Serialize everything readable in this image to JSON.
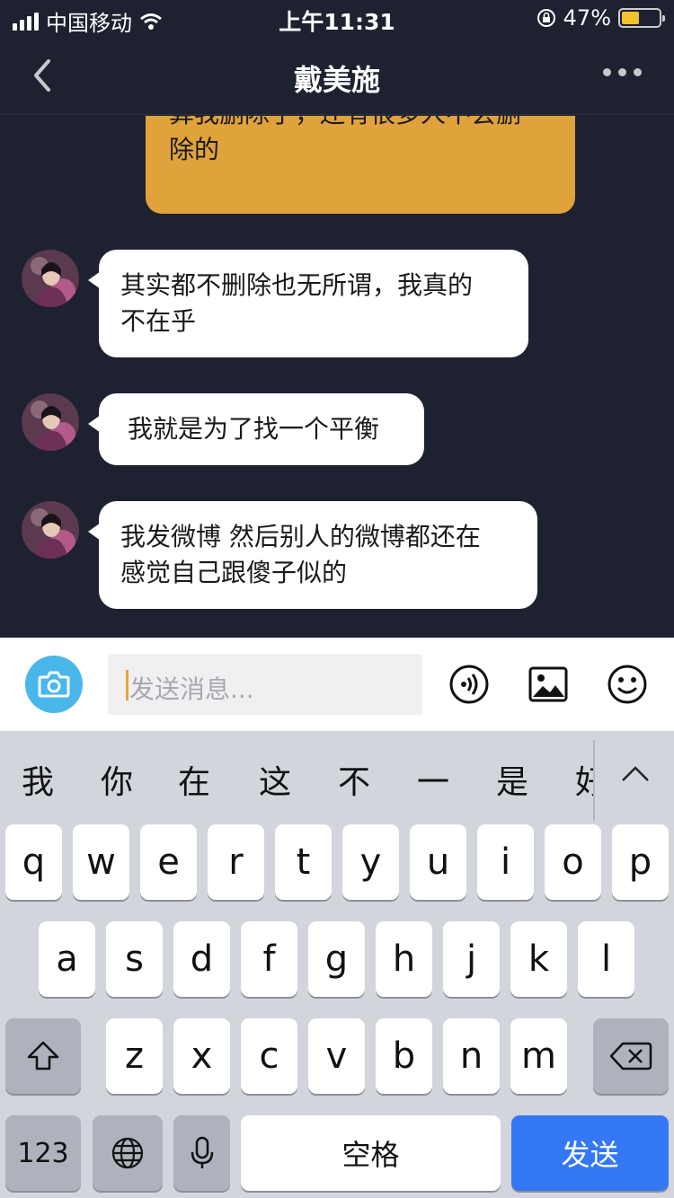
{
  "status_bar": {
    "carrier": "中国移动",
    "time": "上午11:31",
    "battery_percent": "47%",
    "battery_level": 0.47,
    "icons": [
      "signal-icon",
      "wifi-icon",
      "rotation-lock-icon",
      "battery-icon"
    ]
  },
  "nav": {
    "title": "戴美施",
    "back_icon": "chevron-left-icon",
    "more_icon": "more-dots-icon"
  },
  "messages": {
    "self_partial": "算我删除了，还有很多人不会删除的",
    "self_line1": "算我删除了，还有很多人不会删",
    "self_line2": "除的",
    "m1_line1": "其实都不删除也无所谓，我真的",
    "m1_line2": "不在乎",
    "m2_line1": "我就是为了找一个平衡",
    "m3_line1": "我发微博 然后别人的微博都还在",
    "m3_line2": "感觉自己跟傻子似的"
  },
  "input": {
    "placeholder": "发送消息...",
    "icons": [
      "camera-icon",
      "voice-icon",
      "image-icon",
      "emoji-icon"
    ]
  },
  "keyboard": {
    "candidates": [
      "我",
      "你",
      "在",
      "这",
      "不",
      "一",
      "是",
      "好"
    ],
    "row1": [
      "q",
      "w",
      "e",
      "r",
      "t",
      "y",
      "u",
      "i",
      "o",
      "p"
    ],
    "row2": [
      "a",
      "s",
      "d",
      "f",
      "g",
      "h",
      "j",
      "k",
      "l"
    ],
    "row3": [
      "z",
      "x",
      "c",
      "v",
      "b",
      "n",
      "m"
    ],
    "num_key": "123",
    "space_key": "空格",
    "send_key": "发送",
    "accent": "#3478f6"
  }
}
